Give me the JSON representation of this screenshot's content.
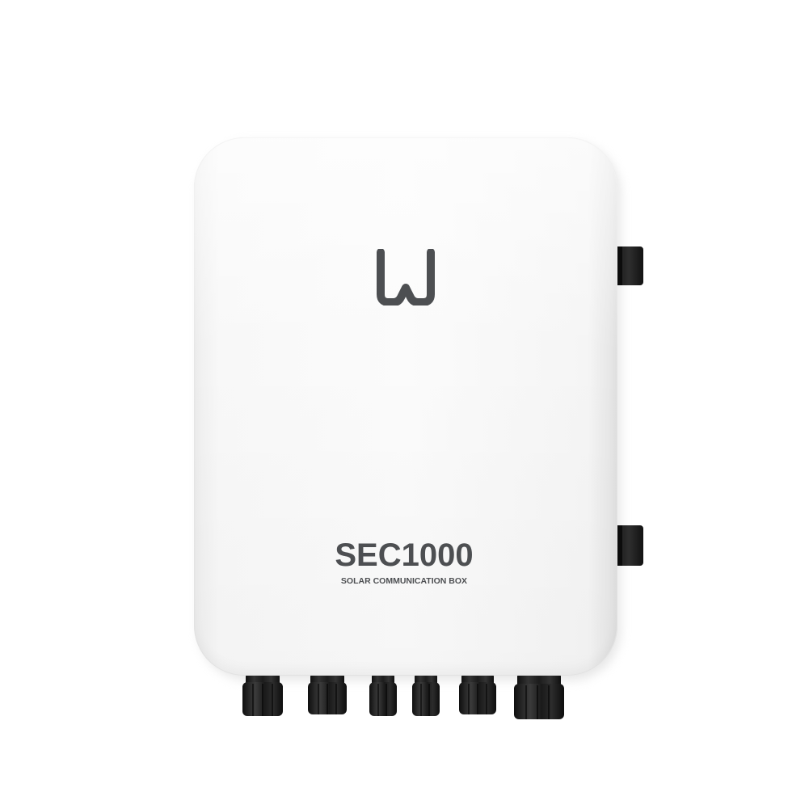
{
  "product": {
    "model": "SEC1000",
    "subtitle": "SOLAR COMMUNICATION BOX",
    "logo_icon": "w-logo-icon"
  },
  "colors": {
    "background": "#ffffff",
    "enclosure": "#f8f8f8",
    "text": "#4d4f52",
    "connectors": "#1a1a1a"
  },
  "connectors": {
    "cable_gland_count": 6,
    "mounting_bracket_count": 2
  }
}
